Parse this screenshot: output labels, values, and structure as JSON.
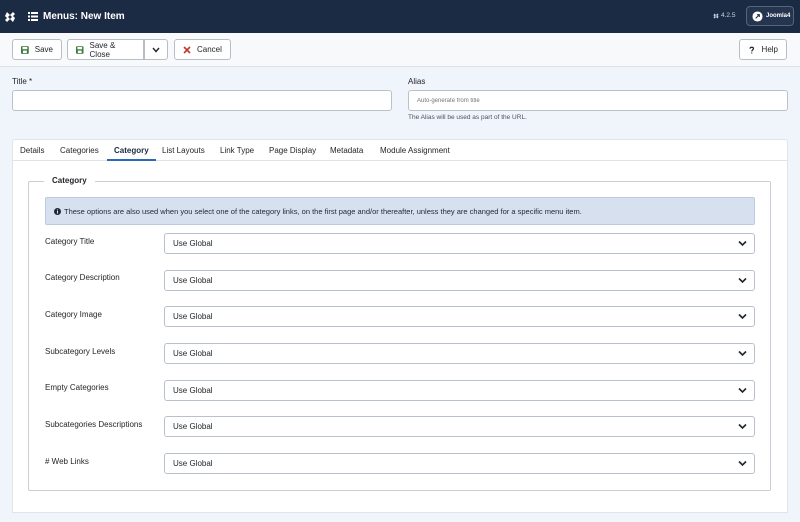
{
  "header": {
    "title": "Menus: New Item",
    "version": "4.2.5",
    "brand_button": "Joomla4"
  },
  "toolbar": {
    "save_label": "Save",
    "save_close_label": "Save & Close",
    "cancel_label": "Cancel",
    "help_label": "Help"
  },
  "form": {
    "title_label": "Title *",
    "title_value": "",
    "alias_label": "Alias",
    "alias_placeholder": "Auto-generate from title",
    "alias_help": "The Alias will be used as part of the URL."
  },
  "tabs": [
    {
      "label": "Details",
      "active": false
    },
    {
      "label": "Categories",
      "active": false
    },
    {
      "label": "Category",
      "active": true
    },
    {
      "label": "List Layouts",
      "active": false
    },
    {
      "label": "Link Type",
      "active": false
    },
    {
      "label": "Page Display",
      "active": false
    },
    {
      "label": "Metadata",
      "active": false
    },
    {
      "label": "Module Assignment",
      "active": false
    }
  ],
  "category_panel": {
    "legend": "Category",
    "info": "These options are also used when you select one of the category links, on the first page and/or thereafter, unless they are changed for a specific menu item.",
    "fields": [
      {
        "label": "Category Title",
        "value": "Use Global"
      },
      {
        "label": "Category Description",
        "value": "Use Global"
      },
      {
        "label": "Category Image",
        "value": "Use Global"
      },
      {
        "label": "Subcategory Levels",
        "value": "Use Global"
      },
      {
        "label": "Empty Categories",
        "value": "Use Global"
      },
      {
        "label": "Subcategories Descriptions",
        "value": "Use Global"
      },
      {
        "label": "# Web Links",
        "value": "Use Global"
      }
    ]
  },
  "icons": {
    "logo": "joomla-logo-icon",
    "menu": "list-icon",
    "save": "floppy-disk-icon",
    "cancel": "close-icon",
    "help": "question-icon",
    "info": "info-circle-icon",
    "select": "chevron-down-icon"
  },
  "colors": {
    "header_bg": "#1c2b44",
    "active_tab": "#2a69b8",
    "save_icon": "#3b7a3f",
    "cancel_icon": "#c0392b",
    "info_bg": "#d6e0ee"
  }
}
